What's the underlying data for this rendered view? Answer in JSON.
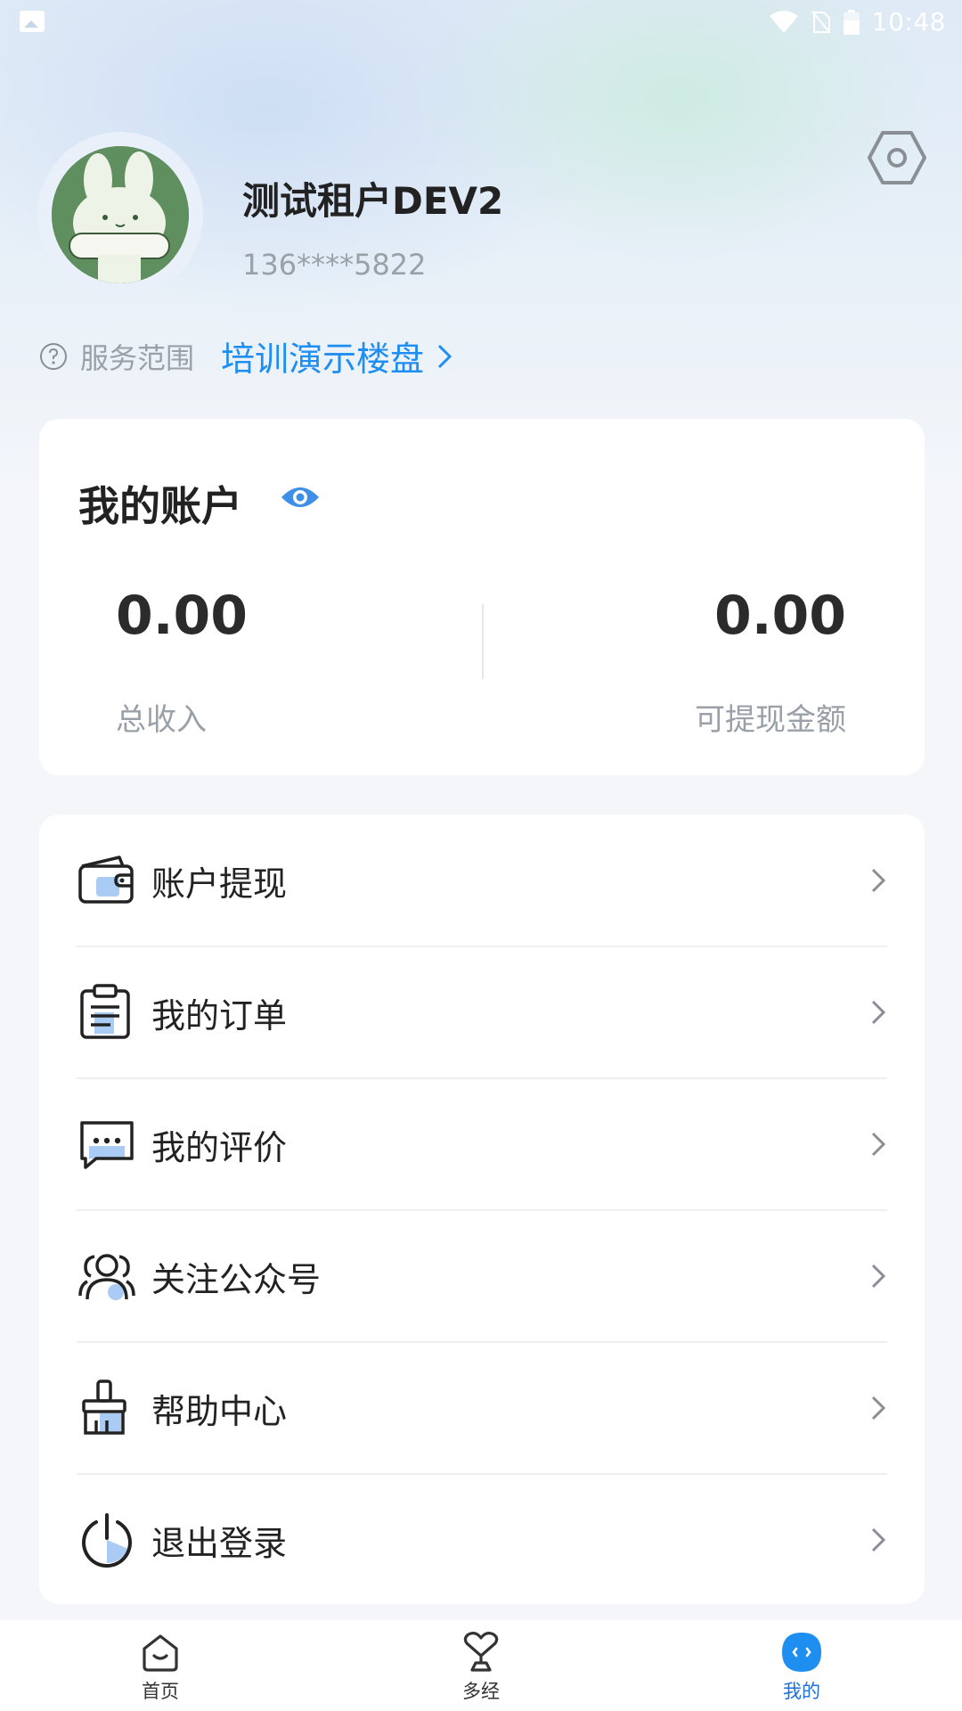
{
  "status_bar": {
    "time": "10:48",
    "icons": [
      "image-icon",
      "wifi-icon",
      "sim-off-icon",
      "battery-icon"
    ]
  },
  "profile": {
    "name": "测试租户DEV2",
    "phone": "136****5822",
    "service_label": "服务范围",
    "service_value": "培训演示楼盘"
  },
  "account": {
    "title": "我的账户",
    "total_income_value": "0.00",
    "total_income_label": "总收入",
    "withdrawable_value": "0.00",
    "withdrawable_label": "可提现金额"
  },
  "menu": {
    "items": [
      {
        "label": "账户提现",
        "icon": "wallet-icon"
      },
      {
        "label": "我的订单",
        "icon": "clipboard-icon"
      },
      {
        "label": "我的评价",
        "icon": "message-icon"
      },
      {
        "label": "关注公众号",
        "icon": "users-icon"
      },
      {
        "label": "帮助中心",
        "icon": "brush-icon"
      },
      {
        "label": "退出登录",
        "icon": "power-icon"
      }
    ]
  },
  "tab_bar": {
    "tabs": [
      {
        "label": "首页",
        "icon": "home-icon",
        "active": false
      },
      {
        "label": "多经",
        "icon": "heart-trophy-icon",
        "active": false
      },
      {
        "label": "我的",
        "icon": "profile-face-icon",
        "active": true
      }
    ]
  },
  "colors": {
    "accent": "#1f8ef1",
    "tab_active": "#1f6fd8",
    "text_primary": "#222222",
    "text_secondary": "#9aa0a8",
    "background": "#f4f6fa"
  }
}
